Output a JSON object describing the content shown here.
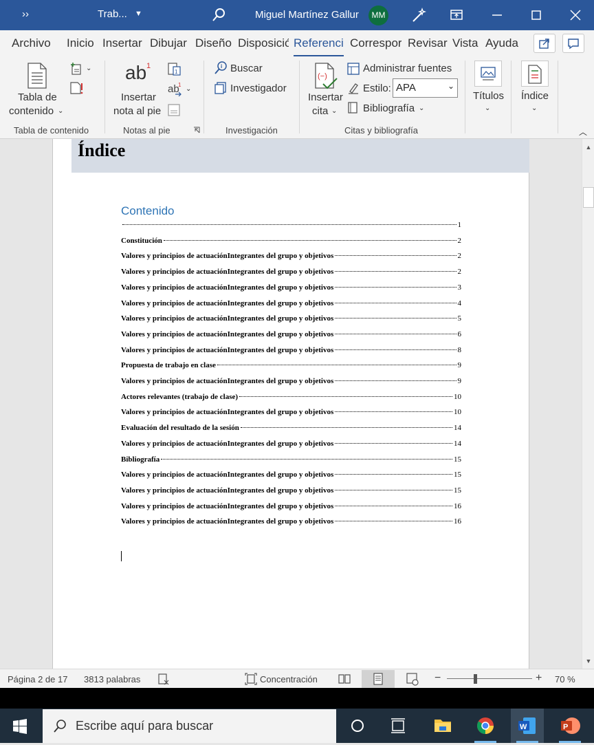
{
  "titlebar": {
    "qa_label": "››",
    "doc_name": "Trab...",
    "user_name": "Miguel Martínez Gallur",
    "avatar_initials": "MM",
    "bg_color": "#2b579a"
  },
  "tabs": [
    "Archivo",
    "Inicio",
    "Insertar",
    "Dibujar",
    "Diseño",
    "Disposició",
    "Referenci",
    "Correspor",
    "Revisar",
    "Vista",
    "Ayuda"
  ],
  "active_tab": "Referenci",
  "ribbon": {
    "toc": {
      "label1": "Tabla de",
      "label2": "contenido",
      "group": "Tabla de contenido"
    },
    "notes": {
      "ab": "ab",
      "sup": "1",
      "label1": "Insertar",
      "label2": "nota al pie",
      "group": "Notas al pie"
    },
    "research": {
      "buscar": "Buscar",
      "investigador": "Investigador",
      "group": "Investigación"
    },
    "citations": {
      "insert1": "Insertar",
      "insert2": "cita",
      "manage": "Administrar fuentes",
      "style_label": "Estilo:",
      "style_value": "APA",
      "biblio": "Bibliografía",
      "group": "Citas y bibliografía"
    },
    "captions": {
      "label": "Títulos"
    },
    "index": {
      "label": "Índice"
    }
  },
  "document": {
    "header_title": "Índice",
    "toc_title": "Contenido",
    "toc_entries": [
      {
        "text": "",
        "page": "1"
      },
      {
        "text": "Constitución",
        "page": "2"
      },
      {
        "text": "Valores y principios de actuaciónIntegrantes del grupo y objetivos",
        "page": "2"
      },
      {
        "text": "Valores y principios de actuaciónIntegrantes del grupo y objetivos",
        "page": "2"
      },
      {
        "text": "Valores y principios de actuaciónIntegrantes del grupo y objetivos",
        "page": "3"
      },
      {
        "text": "Valores y principios de actuaciónIntegrantes del grupo y objetivos",
        "page": "4"
      },
      {
        "text": "Valores y principios de actuaciónIntegrantes del grupo y objetivos",
        "page": "5"
      },
      {
        "text": "Valores y principios de actuaciónIntegrantes del grupo y objetivos",
        "page": "6"
      },
      {
        "text": "Valores y principios de actuaciónIntegrantes del grupo y objetivos",
        "page": "8"
      },
      {
        "text": "Propuesta de trabajo en clase",
        "page": "9"
      },
      {
        "text": "Valores y principios de actuaciónIntegrantes del grupo y objetivos",
        "page": "9"
      },
      {
        "text": "Actores relevantes (trabajo de clase)",
        "page": "10"
      },
      {
        "text": "Valores y principios de actuaciónIntegrantes del grupo y objetivos",
        "page": "10"
      },
      {
        "text": "Evaluación del resultado de la sesión",
        "page": "14"
      },
      {
        "text": "Valores y principios de actuaciónIntegrantes del grupo y objetivos",
        "page": "14"
      },
      {
        "text": "Bibliografía",
        "page": "15"
      },
      {
        "text": "Valores y principios de actuaciónIntegrantes del grupo y objetivos",
        "page": "15"
      },
      {
        "text": "Valores y principios de actuaciónIntegrantes del grupo y objetivos",
        "page": "15"
      },
      {
        "text": "Valores y principios de actuaciónIntegrantes del grupo y objetivos",
        "page": "16"
      },
      {
        "text": "Valores y principios de actuaciónIntegrantes del grupo y objetivos",
        "page": "16"
      }
    ]
  },
  "statusbar": {
    "page": "Página 2 de 17",
    "words": "3813 palabras",
    "focus": "Concentración",
    "zoom_minus": "−",
    "zoom_plus": "+",
    "zoom": "70 %"
  },
  "taskbar": {
    "search_placeholder": "Escribe aquí para buscar"
  }
}
